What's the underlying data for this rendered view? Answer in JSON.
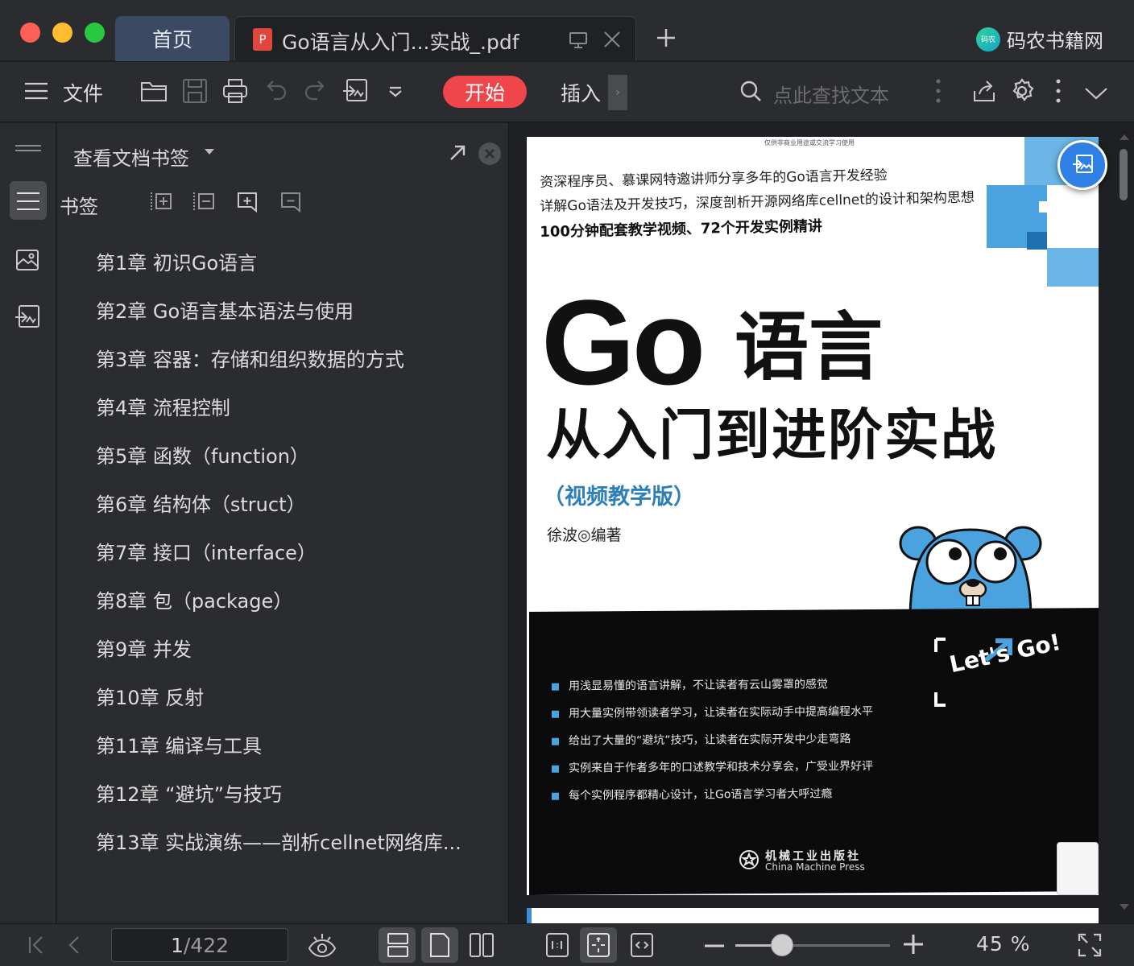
{
  "colors": {
    "accent_red": "#f0454b",
    "home_tab": "#3b4a62",
    "float_button": "#2e7fe6",
    "cover_blue": "#4aa3df"
  },
  "titlebar": {
    "home_tab": "首页",
    "doc_tab_title": "Go语言从入门...实战_.pdf",
    "brand_logo_text": "码农",
    "brand_name": "码农书籍网"
  },
  "toolbar": {
    "menu_label": "文件",
    "start_label": "开始",
    "insert_label": "插入",
    "search_placeholder": "点此查找文本"
  },
  "panel": {
    "title": "查看文档书签",
    "bookmarks_label": "书签",
    "bookmarks": [
      "第1章 初识Go语言",
      "第2章 Go语言基本语法与使用",
      "第3章 容器：存储和组织数据的方式",
      "第4章 流程控制",
      "第5章 函数（function）",
      "第6章 结构体（struct）",
      "第7章 接口（interface）",
      "第8章 包（package）",
      "第9章 并发",
      "第10章 反射",
      "第11章 编译与工具",
      "第12章 “避坑”与技巧",
      "第13章 实战演练——剖析cellnet网络库..."
    ]
  },
  "cover": {
    "top_note": "仅供非商业用途或交流学习使用",
    "line1": "资深程序员、慕课网特邀讲师分享多年的Go语言开发经验",
    "line2": "详解Go语法及开发技巧，深度剖析开源网络库cellnet的设计和架构思想",
    "line3": "100分钟配套教学视频、72个开发实例精讲",
    "title_go": "Go",
    "title_yuyan": "语言",
    "subtitle": "从入门到进阶实战",
    "edition": "（视频教学版）",
    "author": "徐波◎编著",
    "bullets": [
      "用浅显易懂的语言讲解，不让读者有云山雾罩的感觉",
      "用大量实例带领读者学习，让读者在实际动手中提高编程水平",
      "给出了大量的“避坑”技巧，让读者在实际开发中少走弯路",
      "实例来自于作者多年的口述教学和技术分享会，广受业界好评",
      "每个实例程序都精心设计，让Go语言学习者大呼过瘾"
    ],
    "lets_go": "Let's Go!",
    "publisher_cn": "机械工业出版社",
    "publisher_en": "China Machine Press"
  },
  "statusbar": {
    "current_page": "1",
    "total_pages": "/422",
    "zoom_level": "45 %",
    "zoom_fraction": 0.3
  }
}
